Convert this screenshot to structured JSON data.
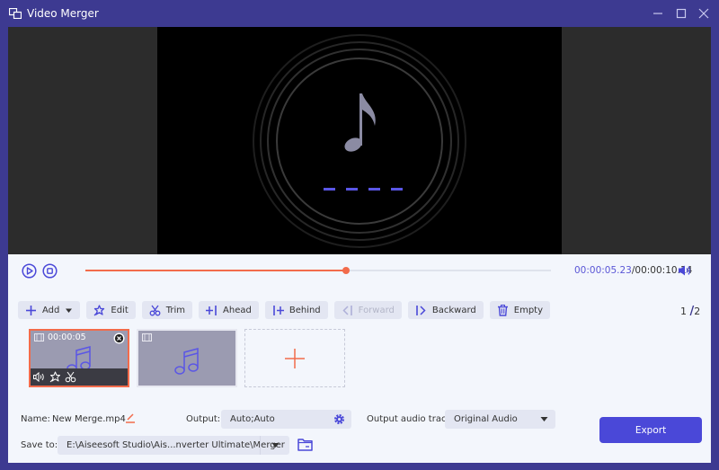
{
  "window": {
    "title": "Video Merger",
    "controls": [
      "minimize",
      "maximize",
      "close"
    ]
  },
  "player": {
    "current_time": "00:00:05.23",
    "separator": "/",
    "total_time": "00:00:10.14",
    "progress": 0.56,
    "buttons": [
      "play",
      "stop",
      "volume"
    ]
  },
  "toolbar": {
    "items": [
      {
        "label": "Add",
        "icon": "plus-icon",
        "has_dropdown": true,
        "enabled": true
      },
      {
        "label": "Edit",
        "icon": "magic-wand-icon",
        "enabled": true
      },
      {
        "label": "Trim",
        "icon": "scissors-icon",
        "enabled": true
      },
      {
        "label": "Ahead",
        "icon": "ahead-icon",
        "enabled": true
      },
      {
        "label": "Behind",
        "icon": "behind-icon",
        "enabled": true
      },
      {
        "label": "Forward",
        "icon": "forward-icon",
        "enabled": false
      },
      {
        "label": "Backward",
        "icon": "backward-icon",
        "enabled": true
      },
      {
        "label": "Empty",
        "icon": "trash-icon",
        "enabled": true
      }
    ]
  },
  "pager": {
    "current": "1",
    "slash": "/",
    "total": "2"
  },
  "clips": [
    {
      "duration": "00:00:05",
      "selected": true
    },
    {
      "duration": "",
      "selected": false
    }
  ],
  "bottom": {
    "name_label": "Name:",
    "name_value": "New Merge.mp4",
    "output_label": "Output:",
    "output_value": "Auto;Auto",
    "audio_label": "Output audio track:",
    "audio_value": "Original Audio",
    "save_label": "Save to:",
    "save_value": "E:\\Aiseesoft Studio\\Ais...nverter Ultimate\\Merger",
    "export_label": "Export"
  },
  "colors": {
    "brand": "#3d3a91",
    "accent": "#4a48d8",
    "highlight": "#f26b4b",
    "panel_bg": "#f3f6fc"
  }
}
